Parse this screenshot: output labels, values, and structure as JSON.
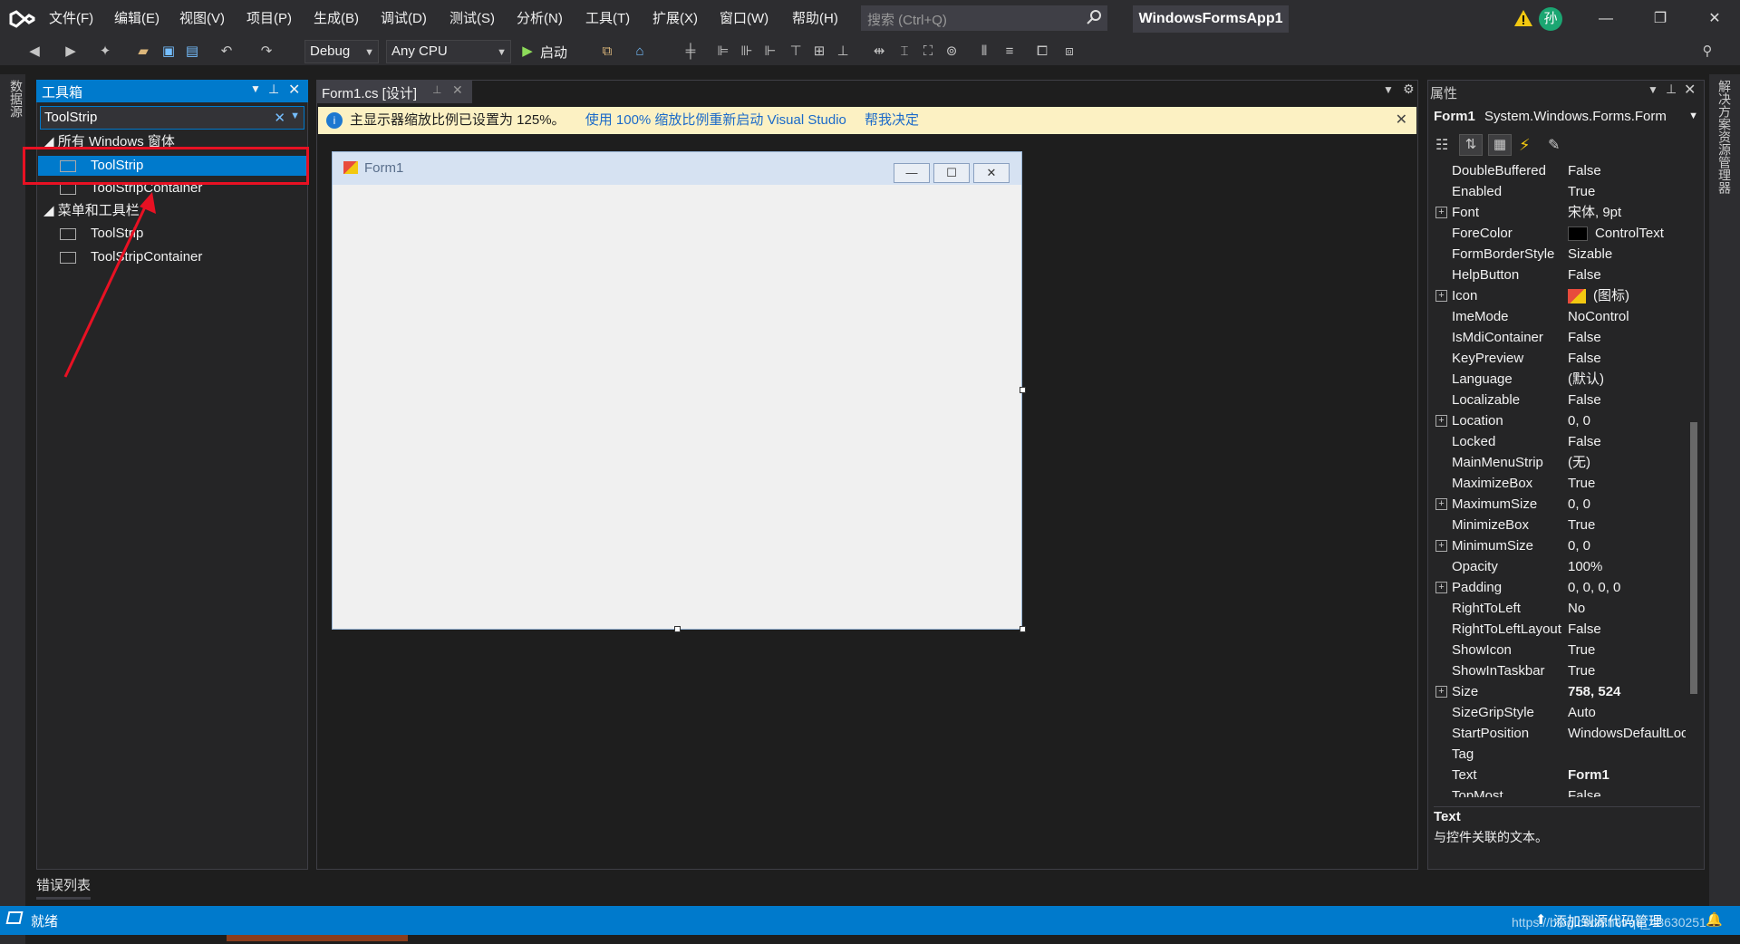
{
  "title_bar": {
    "menus": [
      "文件(F)",
      "编辑(E)",
      "视图(V)",
      "项目(P)",
      "生成(B)",
      "调试(D)",
      "测试(S)",
      "分析(N)",
      "工具(T)",
      "扩展(X)",
      "窗口(W)",
      "帮助(H)"
    ],
    "search_placeholder": "搜索 (Ctrl+Q)",
    "app_title": "WindowsFormsApp1",
    "user_initial": "孙"
  },
  "toolbar": {
    "config": "Debug",
    "platform": "Any CPU",
    "start_label": "启动"
  },
  "left_side": {
    "datasource_tab": "数据源"
  },
  "toolbox": {
    "title": "工具箱",
    "search_value": "ToolStrip",
    "groups": [
      {
        "name": "所有 Windows 窗体",
        "items": [
          "ToolStrip",
          "ToolStripContainer"
        ]
      },
      {
        "name": "菜单和工具栏",
        "items": [
          "ToolStrip",
          "ToolStripContainer"
        ]
      }
    ]
  },
  "document": {
    "tab": "Form1.cs [设计]",
    "info": "主显示器缩放比例已设置为 125%。",
    "info_link1": "使用 100% 缩放比例重新启动 Visual Studio",
    "info_link2": "帮我决定"
  },
  "form": {
    "title": "Form1"
  },
  "properties": {
    "title": "属性",
    "object_name": "Form1",
    "object_type": "System.Windows.Forms.Form",
    "rows": [
      {
        "name": "DoubleBuffered",
        "value": "False"
      },
      {
        "name": "Enabled",
        "value": "True"
      },
      {
        "name": "Font",
        "value": "宋体, 9pt"
      },
      {
        "name": "ForeColor",
        "value": "ControlText"
      },
      {
        "name": "FormBorderStyle",
        "value": "Sizable"
      },
      {
        "name": "HelpButton",
        "value": "False"
      },
      {
        "name": "Icon",
        "value": "(图标)"
      },
      {
        "name": "ImeMode",
        "value": "NoControl"
      },
      {
        "name": "IsMdiContainer",
        "value": "False"
      },
      {
        "name": "KeyPreview",
        "value": "False"
      },
      {
        "name": "Language",
        "value": "(默认)"
      },
      {
        "name": "Localizable",
        "value": "False"
      },
      {
        "name": "Location",
        "value": "0, 0"
      },
      {
        "name": "Locked",
        "value": "False"
      },
      {
        "name": "MainMenuStrip",
        "value": "(无)"
      },
      {
        "name": "MaximizeBox",
        "value": "True"
      },
      {
        "name": "MaximumSize",
        "value": "0, 0"
      },
      {
        "name": "MinimizeBox",
        "value": "True"
      },
      {
        "name": "MinimumSize",
        "value": "0, 0"
      },
      {
        "name": "Opacity",
        "value": "100%"
      },
      {
        "name": "Padding",
        "value": "0, 0, 0, 0"
      },
      {
        "name": "RightToLeft",
        "value": "No"
      },
      {
        "name": "RightToLeftLayout",
        "value": "False"
      },
      {
        "name": "ShowIcon",
        "value": "True"
      },
      {
        "name": "ShowInTaskbar",
        "value": "True"
      },
      {
        "name": "Size",
        "value": "758, 524"
      },
      {
        "name": "SizeGripStyle",
        "value": "Auto"
      },
      {
        "name": "StartPosition",
        "value": "WindowsDefaultLocation"
      },
      {
        "name": "Tag",
        "value": ""
      },
      {
        "name": "Text",
        "value": "Form1"
      },
      {
        "name": "TopMost",
        "value": "False"
      }
    ],
    "desc_title": "Text",
    "desc_body": "与控件关联的文本。"
  },
  "right_side": {
    "solution_tab": "解决方案资源管理器"
  },
  "bottom": {
    "error_tab": "错误列表"
  },
  "status": {
    "ready": "就绪",
    "source_control": "添加到源代码管理",
    "watermark": "https://blog.csdn.net/qq_43630251"
  },
  "colors": {
    "accent": "#007acc",
    "highlight": "#e81123"
  }
}
